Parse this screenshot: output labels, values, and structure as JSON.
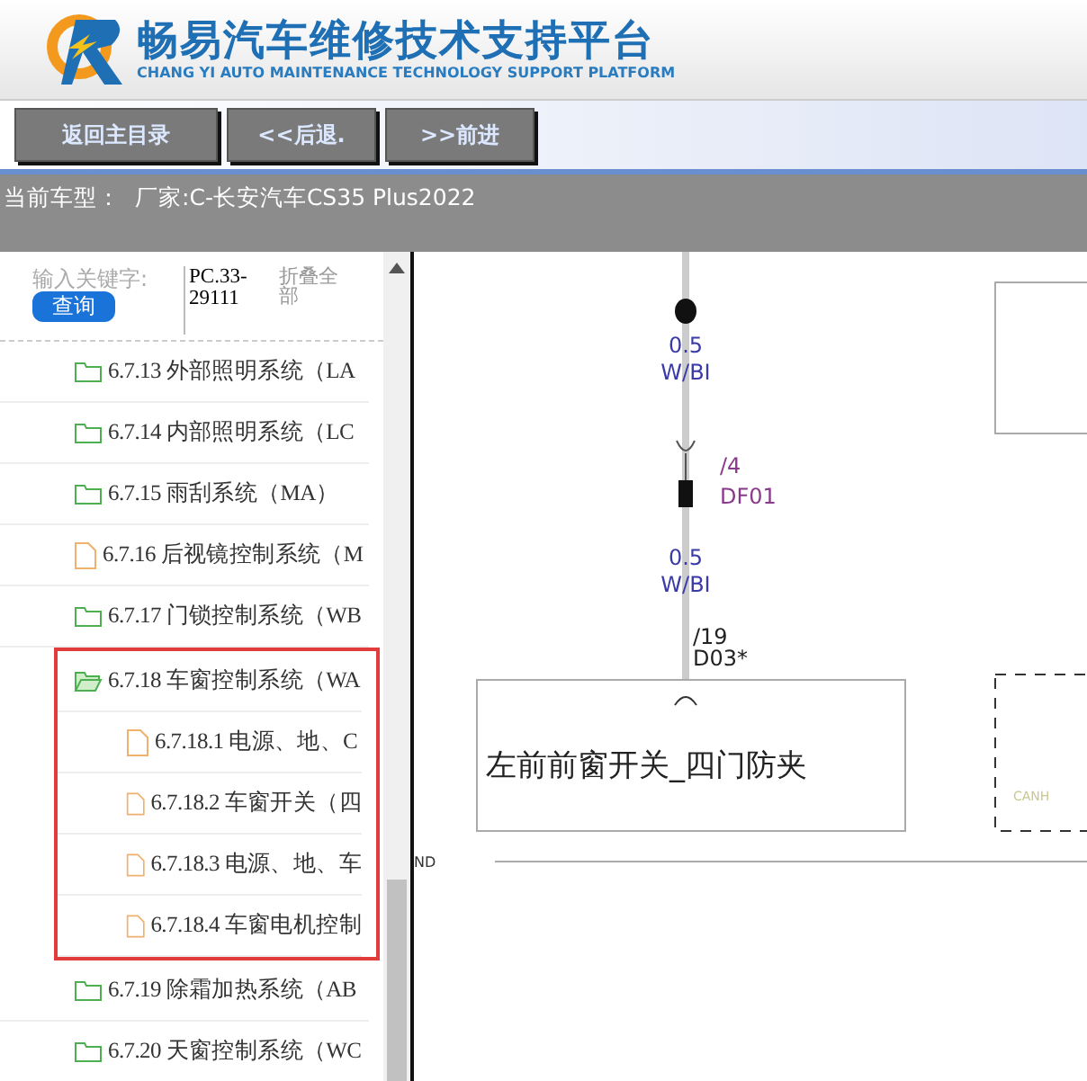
{
  "header": {
    "title": "畅易汽车维修技术支持平台",
    "subtitle": "CHANG YI AUTO MAINTENANCE TECHNOLOGY SUPPORT PLATFORM"
  },
  "toolbar": {
    "buttons": [
      "返回主目录",
      "<<后退.",
      ">>前进"
    ]
  },
  "vehicle_bar": {
    "label": "当前车型：",
    "value": "厂家:C-长安汽车CS35 Plus2022"
  },
  "search": {
    "placeholder": "输入关键字:",
    "button": "查询",
    "code": "PC.33-29111",
    "collapse_link": "折叠全部"
  },
  "tree": [
    {
      "label": "6.7.13 外部照明系统（LA",
      "kind": "folder",
      "expanded": false,
      "highlighted": false
    },
    {
      "label": "6.7.14 内部照明系统（LC",
      "kind": "folder",
      "expanded": false,
      "highlighted": false
    },
    {
      "label": "6.7.15 雨刮系统（MA）",
      "kind": "folder",
      "expanded": false,
      "highlighted": false
    },
    {
      "label": "6.7.16 后视镜控制系统（M",
      "kind": "file",
      "expanded": false,
      "highlighted": false
    },
    {
      "label": "6.7.17 门锁控制系统（WB",
      "kind": "folder",
      "expanded": false,
      "highlighted": false
    },
    {
      "label": "6.7.18 车窗控制系统（WA",
      "kind": "folder",
      "expanded": true,
      "highlighted": true,
      "children": [
        {
          "label": "6.7.18.1 电源、地、C",
          "kind": "file"
        },
        {
          "label": "6.7.18.2 车窗开关（四",
          "kind": "file"
        },
        {
          "label": "6.7.18.3 电源、地、车",
          "kind": "file"
        },
        {
          "label": "6.7.18.4 车窗电机控制",
          "kind": "file"
        }
      ]
    },
    {
      "label": "6.7.19 除霜加热系统（AB",
      "kind": "folder",
      "expanded": false,
      "highlighted": false
    },
    {
      "label": "6.7.20 天窗控制系统（WC",
      "kind": "folder",
      "expanded": false,
      "highlighted": false
    }
  ],
  "diagram": {
    "wire_labels": [
      {
        "size": "0.5",
        "code": "W/BI"
      },
      {
        "size": "0.5",
        "code": "W/BI"
      }
    ],
    "connectors": [
      {
        "pin": "/4",
        "name": "DF01"
      },
      {
        "pin": "/19",
        "name": "D03*"
      }
    ],
    "component": "左前前窗开关_四门防夹",
    "signal": "CANH",
    "ground_label": "ND"
  }
}
